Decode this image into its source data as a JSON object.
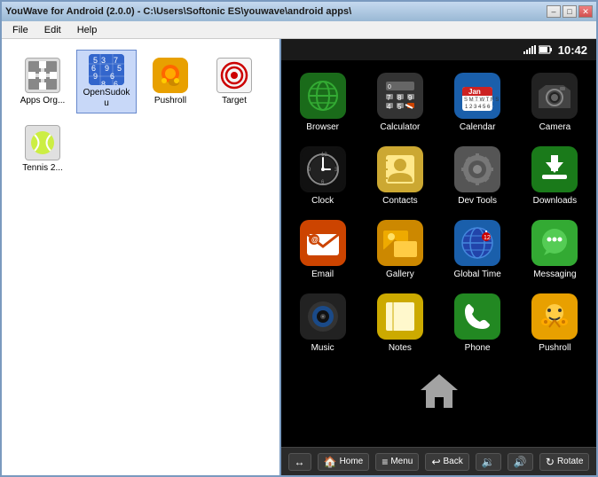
{
  "window": {
    "title": "YouWave for Android (2.0.0) - C:\\Users\\Softonic ES\\youwave\\android apps\\",
    "controls": {
      "minimize": "–",
      "maximize": "□",
      "close": "✕"
    }
  },
  "menu": {
    "items": [
      "File",
      "Edit",
      "Help"
    ]
  },
  "android": {
    "time": "10:42",
    "apps_row1": [
      {
        "id": "browser",
        "label": "Browser",
        "icon": "🌐"
      },
      {
        "id": "calculator",
        "label": "Calculator",
        "icon": "="
      },
      {
        "id": "calendar",
        "label": "Calendar",
        "icon": "📅"
      },
      {
        "id": "camera",
        "label": "Camera",
        "icon": "📷"
      }
    ],
    "apps_row2": [
      {
        "id": "clock",
        "label": "Clock",
        "icon": "🕐"
      },
      {
        "id": "contacts",
        "label": "Contacts",
        "icon": "👤"
      },
      {
        "id": "devtools",
        "label": "Dev Tools",
        "icon": "⚙"
      },
      {
        "id": "downloads",
        "label": "Downloads",
        "icon": "⬇"
      }
    ],
    "apps_row3": [
      {
        "id": "email",
        "label": "Email",
        "icon": "@"
      },
      {
        "id": "gallery",
        "label": "Gallery",
        "icon": "🖼"
      },
      {
        "id": "globaltime",
        "label": "Global Time",
        "icon": "🌍"
      },
      {
        "id": "messaging",
        "label": "Messaging",
        "icon": "😊"
      }
    ],
    "apps_row4": [
      {
        "id": "music",
        "label": "Music",
        "icon": "🎵"
      },
      {
        "id": "notes",
        "label": "Notes",
        "icon": "📝"
      },
      {
        "id": "phone",
        "label": "Phone",
        "icon": "📞"
      },
      {
        "id": "pushroll",
        "label": "Pushroll",
        "icon": "😸"
      }
    ],
    "bottom_bar": [
      {
        "id": "back-back",
        "icon": "↩",
        "label": ""
      },
      {
        "id": "home",
        "icon": "🏠",
        "label": "Home"
      },
      {
        "id": "menu",
        "icon": "≡",
        "label": "Menu"
      },
      {
        "id": "back",
        "icon": "↩",
        "label": "Back"
      },
      {
        "id": "vol-down",
        "icon": "🔉",
        "label": ""
      },
      {
        "id": "vol-up",
        "icon": "🔊",
        "label": ""
      },
      {
        "id": "rotate",
        "icon": "↻",
        "label": "Rotate"
      }
    ]
  },
  "pc_apps": [
    {
      "id": "appsorg",
      "label": "Apps Org...",
      "color": "#e8e8e8"
    },
    {
      "id": "opensudoku",
      "label": "OpenSudoku",
      "color": "#3366cc"
    },
    {
      "id": "pushroll",
      "label": "Pushroll",
      "color": "#e8a000"
    },
    {
      "id": "target",
      "label": "Target",
      "color": "#f0f0f0"
    },
    {
      "id": "tennis",
      "label": "Tennis 2...",
      "color": "#e0e0e0"
    }
  ]
}
